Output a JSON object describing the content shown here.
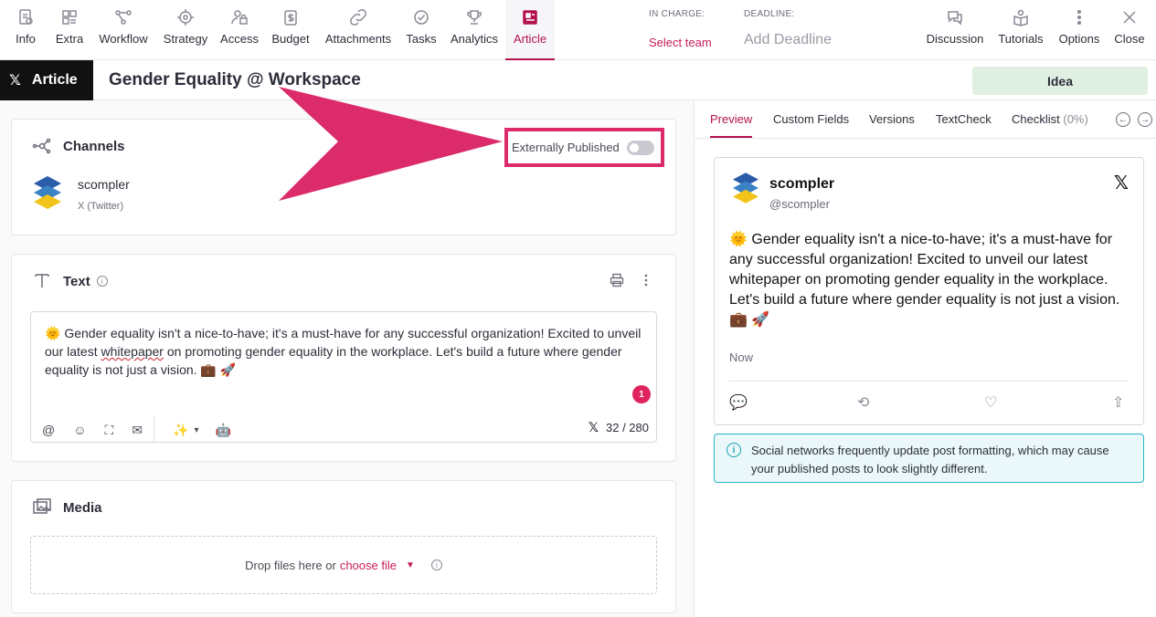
{
  "nav": [
    {
      "label": "Info",
      "icon": "info-doc-icon"
    },
    {
      "label": "Extra",
      "icon": "extra-grid-icon"
    },
    {
      "label": "Workflow",
      "icon": "workflow-icon"
    },
    {
      "label": "Strategy",
      "icon": "strategy-target-icon"
    },
    {
      "label": "Access",
      "icon": "access-user-lock-icon"
    },
    {
      "label": "Budget",
      "icon": "budget-icon"
    },
    {
      "label": "Attachments",
      "icon": "attachment-link-icon"
    },
    {
      "label": "Tasks",
      "icon": "tasks-check-icon"
    },
    {
      "label": "Analytics",
      "icon": "analytics-trophy-icon"
    },
    {
      "label": "Article",
      "icon": "article-newspaper-icon"
    }
  ],
  "in_charge": {
    "caption": "IN CHARGE:",
    "value": "Select team"
  },
  "deadline": {
    "caption": "DEADLINE:",
    "value": "Add Deadline"
  },
  "right_nav": [
    {
      "label": "Discussion",
      "icon": "discussion-icon"
    },
    {
      "label": "Tutorials",
      "icon": "tutorials-icon"
    },
    {
      "label": "Options",
      "icon": "options-dots-icon"
    },
    {
      "label": "Close",
      "icon": "close-icon"
    }
  ],
  "title_bar": {
    "chip_label": "Article",
    "title": "Gender Equality @ Workspace",
    "status_button": "Idea"
  },
  "channels": {
    "heading": "Channels",
    "toggle_label": "Externally Published",
    "toggle_on": false,
    "account_name": "scompler",
    "account_network": "X (Twitter)"
  },
  "text_card": {
    "heading": "Text",
    "content_before": "🌞 Gender equality isn't a nice-to-have; it's a must-have for any successful organization! Excited to unveil our latest ",
    "content_misspelled": "whitepaper",
    "content_after": " on promoting gender equality in the workplace. Let's build a future where gender equality is not just a vision. 💼 🚀",
    "error_count": "1",
    "char_count": "32 / 280"
  },
  "media": {
    "heading": "Media",
    "drop_text": "Drop files here or",
    "choose_link": "choose file"
  },
  "tabs": {
    "preview": "Preview",
    "custom_fields": "Custom Fields",
    "versions": "Versions",
    "textcheck": "TextCheck",
    "checklist": "Checklist",
    "checklist_count": "(0%)"
  },
  "preview": {
    "name": "scompler",
    "handle": "@scompler",
    "text": "🌞 Gender equality isn't a nice-to-have; it's a must-have for any successful organization! Excited to unveil our latest whitepaper on promoting gender equality in the workplace. Let's build a future where gender equality is not just a vision. 💼 🚀",
    "time": "Now"
  },
  "notice": "Social networks frequently update post formatting, which may cause your published posts to look slightly different.",
  "colors": {
    "accent": "#b3124f",
    "annotation": "#dc2b6a",
    "idea_bg": "#dff0e3",
    "notice_border": "#27b3c6"
  }
}
